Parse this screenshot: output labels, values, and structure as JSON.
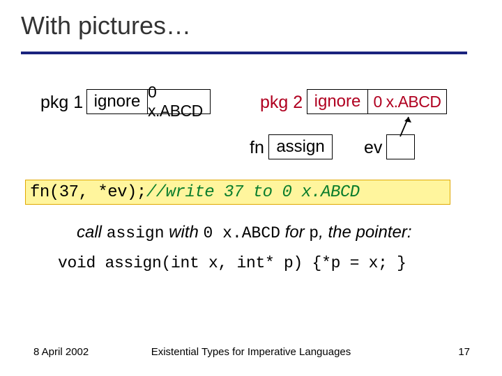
{
  "title": "With pictures…",
  "pkg1": {
    "label": "pkg 1",
    "cell1": "ignore",
    "cell2": "0 x.ABCD"
  },
  "pkg2": {
    "label": "pkg 2",
    "cell1": "ignore",
    "cell2": "0 x.ABCD"
  },
  "fn": {
    "label": "fn",
    "box": "assign"
  },
  "ev": {
    "label": "ev"
  },
  "code": {
    "call": "fn(37, *ev); ",
    "comment": "//write 37 to 0 x.ABCD"
  },
  "caption": {
    "t1": "call ",
    "assign": "assign",
    "t2": " with ",
    "addr": "0 x.ABCD",
    "t3": " for ",
    "p": "p",
    "t4": ", the pointer:"
  },
  "sig": "void assign(int x, int* p) {*p = x; }",
  "footer": {
    "date": "8 April 2002",
    "title": "Existential Types for Imperative Languages",
    "page": "17"
  }
}
